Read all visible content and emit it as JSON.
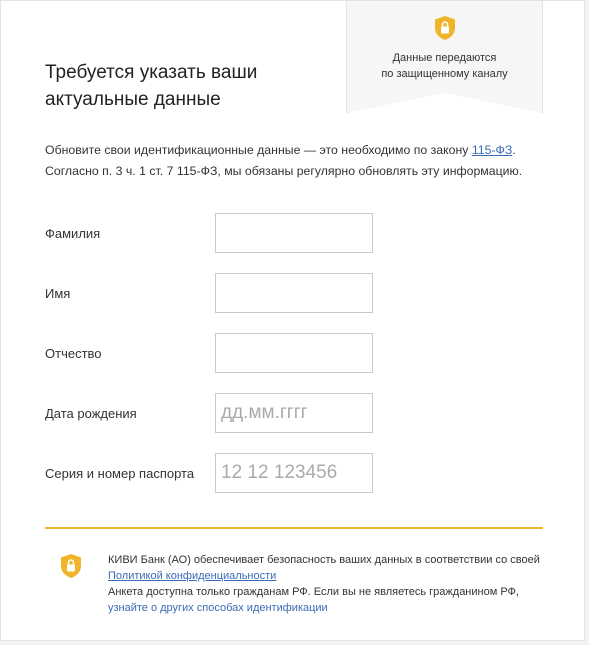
{
  "secure_badge": {
    "icon": "shield-lock-icon",
    "line1": "Данные передаются",
    "line2": "по защищенному каналу"
  },
  "title": {
    "line1": "Требуется указать ваши",
    "line2": "актуальные данные"
  },
  "intro": {
    "text_before_link": "Обновите свои идентификационные данные — это необходимо по закону ",
    "law_link": "115-ФЗ",
    "text_after_link": ".",
    "line2": "Согласно п. 3 ч. 1 ст. 7 115-ФЗ, мы обязаны регулярно обновлять эту информацию."
  },
  "form": {
    "fields": [
      {
        "label": "Фамилия",
        "value": "",
        "placeholder": ""
      },
      {
        "label": "Имя",
        "value": "",
        "placeholder": ""
      },
      {
        "label": "Отчество",
        "value": "",
        "placeholder": ""
      },
      {
        "label": "Дата рождения",
        "value": "",
        "placeholder": "дд.мм.гггг"
      },
      {
        "label": "Серия и номер паспорта",
        "value": "",
        "placeholder": "12 12 123456"
      }
    ]
  },
  "footer": {
    "icon": "shield-lock-icon",
    "line1": "КИВИ Банк (АО) обеспечивает безопасность ваших данных в соответствии со своей",
    "privacy_link": "Политикой конфиденциальности",
    "line3": "Анкета доступна только гражданам РФ. Если вы не являетесь гражданином РФ,",
    "other_methods_link": "узнайте о других способах идентификации"
  },
  "colors": {
    "accent": "#f0b429",
    "link": "#3a6bb7"
  }
}
